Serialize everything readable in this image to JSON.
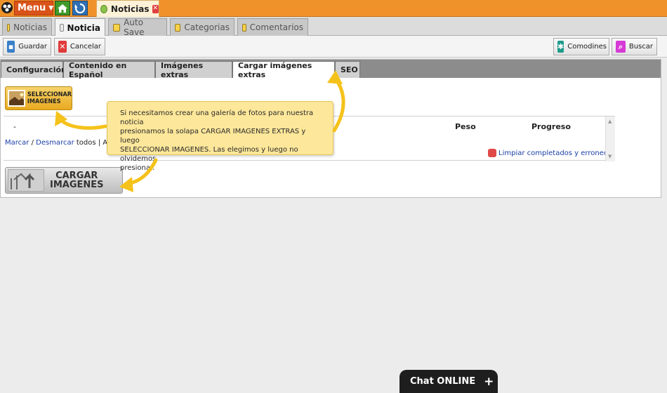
{
  "topbar": {
    "menu_label": "Menu",
    "doc_tab_label": "Noticias"
  },
  "tabs": [
    {
      "label": "Noticias",
      "active": false
    },
    {
      "label": "Noticia",
      "active": true
    },
    {
      "label": "Auto Save",
      "active": false
    },
    {
      "label": "Categorias",
      "active": false
    },
    {
      "label": "Comentarios",
      "active": false
    }
  ],
  "toolbar": {
    "save_label": "Guardar",
    "cancel_label": "Cancelar",
    "wildcards_label": "Comodines",
    "search_label": "Buscar"
  },
  "inner_tabs": [
    {
      "label": "Configuración",
      "active": false
    },
    {
      "label": "Contenido en Español",
      "active": false
    },
    {
      "label": "Imágenes extras",
      "active": false
    },
    {
      "label": "Cargar imágenes extras",
      "active": true
    },
    {
      "label": "SEO",
      "active": false
    }
  ],
  "upload": {
    "select_button_line1": "SELECCIONAR",
    "select_button_line2": "IMAGENES",
    "col_dash": "-",
    "col_size": "Peso",
    "col_progress": "Progreso",
    "mark_link": "Marcar",
    "unmark_link": "Desmarcar",
    "mark_rest": " todos | Acc",
    "clear_link": "Limpiar completados y erroneos",
    "load_button_line1": "CARGAR",
    "load_button_line2": "IMAGENES"
  },
  "tooltip": {
    "text_line1": "Si necesitamos crear una galería de fotos para nuestra noticia",
    "text_line2": "presionamos la solapa CARGAR IMAGENES EXTRAS y luego",
    "text_line3": "SELECCIONAR IMAGENES. Las  elegimos y luego no olvidemos",
    "text_line4": "presionar."
  },
  "chat": {
    "label": "Chat ONLINE",
    "plus": "+"
  },
  "colors": {
    "topbar_orange": "#f0922a",
    "tooltip_yellow": "#fde79a",
    "arrow_yellow": "#f5c21b",
    "link_blue": "#1a3fa8"
  }
}
